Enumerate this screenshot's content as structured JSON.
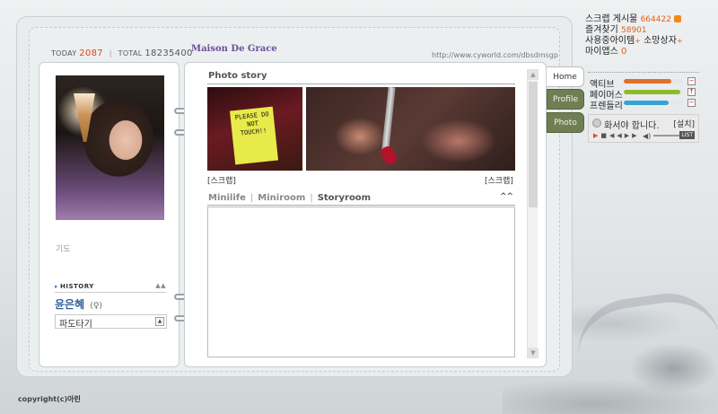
{
  "counters": {
    "today_label": "TODAY",
    "today_value": "2087",
    "sep": "|",
    "total_label": "TOTAL",
    "total_value": "18235400"
  },
  "site_title": "Maison De Grace",
  "site_url": "http://www.cyworld.com/dbsdmsgp",
  "left_panel": {
    "mood": "기도",
    "history_label": "HISTORY",
    "history_toggle": "▲▲",
    "owner_name": "윤은혜",
    "owner_sub": "(♀)",
    "wave_label": "파도타기",
    "wave_button": "▲"
  },
  "main": {
    "photo_story_title": "Photo story",
    "sticky_note": "PLEASE DO NOT TOUCH!!",
    "scrap_left": "[스크랩]",
    "scrap_right": "[스크랩]",
    "room_tabs": [
      "Minilife",
      "Miniroom",
      "Storyroom"
    ],
    "room_sep": "|",
    "room_toggle": "^^"
  },
  "tabs": {
    "home": "Home",
    "profile": "Profile",
    "photo": "Photo"
  },
  "info": {
    "scrap_label": "스크랩 게시물",
    "scrap_count": "664422",
    "fav_label": "즐겨찾기",
    "fav_count": "58901",
    "items_label": "사용중아이템",
    "items_plus": "+",
    "wish_label": "소망상자",
    "wish_plus": "+",
    "myapps_label": "마이앱스",
    "myapps_count": "0"
  },
  "stats": [
    {
      "label": "액티브",
      "level": 0.8,
      "color": "#e0702a",
      "button": "−"
    },
    {
      "label": "페이머스",
      "level": 0.95,
      "color": "#8dbb2c",
      "button": "↑"
    },
    {
      "label": "프렌들리",
      "level": 0.75,
      "color": "#36a3d6",
      "button": "−"
    }
  ],
  "player": {
    "song": "화서야 합니다.",
    "setup": "[설치]",
    "list": "LIST"
  },
  "copyright": {
    "label": "copyright(c)",
    "name": "아린"
  }
}
